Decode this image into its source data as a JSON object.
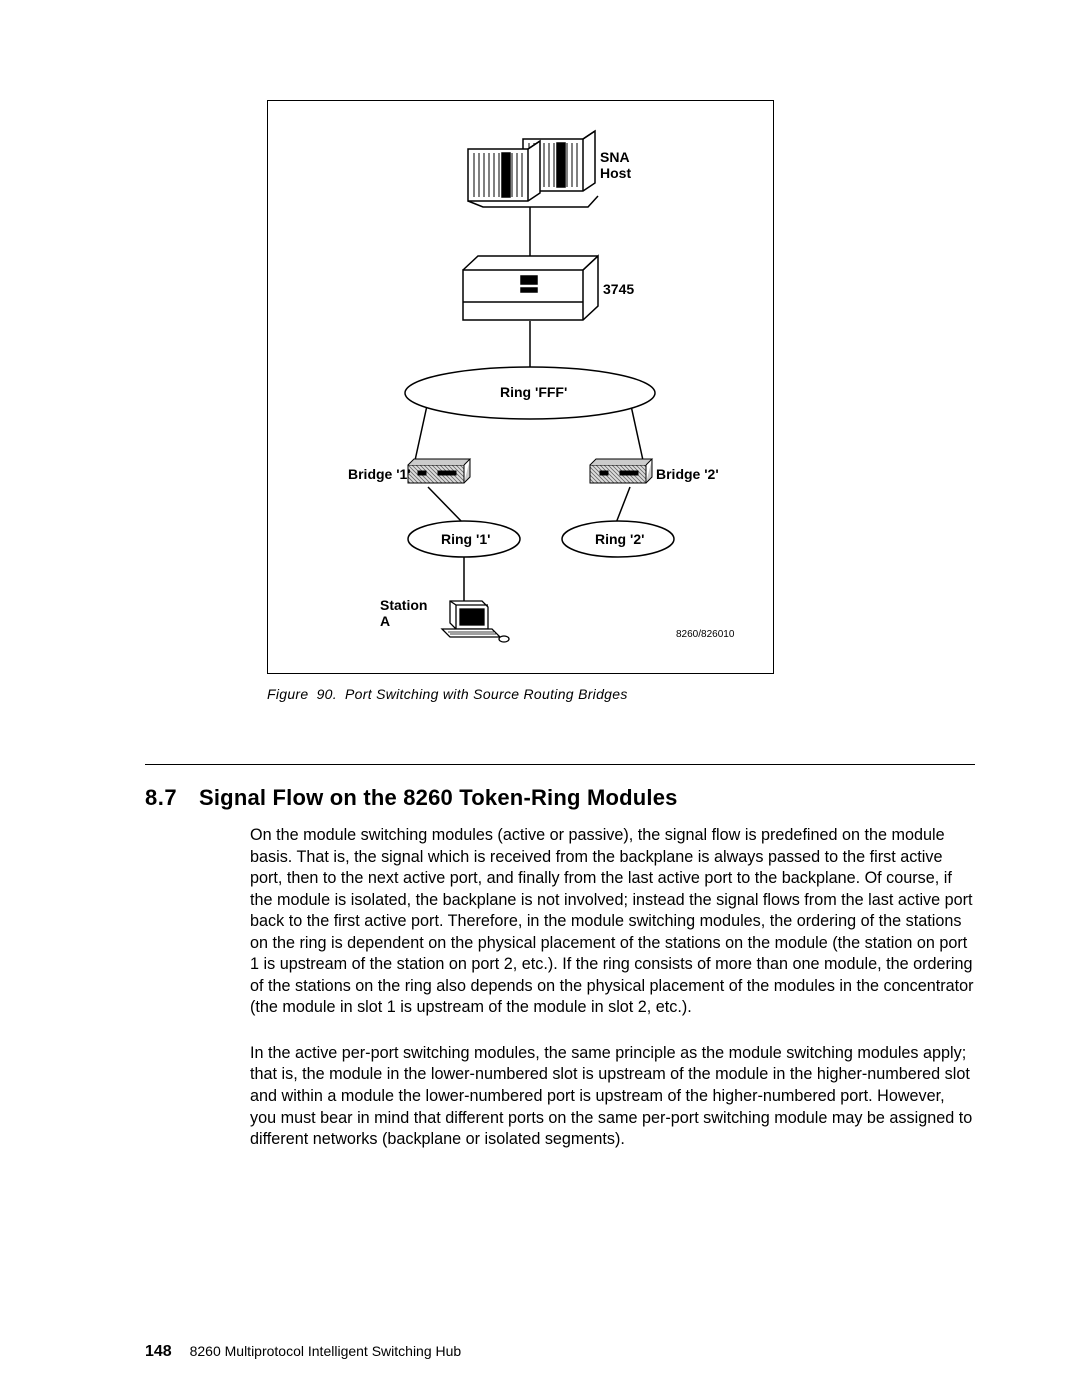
{
  "diagram": {
    "labels": {
      "sna_host": "SNA\nHost",
      "fep": "3745",
      "ring_top": "Ring 'FFF'",
      "bridge_left": "Bridge '1'",
      "bridge_right": "Bridge '2'",
      "ring_left": "Ring '1'",
      "ring_right": "Ring '2'",
      "station": "Station\nA",
      "refcode": "8260/826010"
    }
  },
  "caption": "Figure 90. Port Switching with Source Routing Bridges",
  "section": {
    "number": "8.7",
    "title": "Signal Flow on the 8260 Token-Ring Modules",
    "paragraphs": [
      "On the module switching modules (active or passive), the signal flow is predefined on the module basis.  That is, the signal which is received from the backplane is always passed to the first active port, then to the next active port, and finally from the last active port to the backplane.  Of course, if the module is isolated, the backplane is not involved; instead the signal flows from the last active port back to the first active port.   Therefore, in the module switching modules, the ordering of the stations on the ring is dependent on the physical placement of the stations on the module (the station on port 1 is upstream of the station on port 2, etc.).  If the ring consists of more than one module, the ordering of the stations on the ring also depends on the physical placement of the modules in the concentrator (the module in slot 1 is upstream of the module in slot 2, etc.).",
      "In the active per-port switching modules, the same principle as the module switching modules apply; that is, the module in the lower-numbered slot is upstream of the module in the higher-numbered slot and within a module the lower-numbered port is upstream of the higher-numbered port.  However, you must bear in mind that different ports on the same per-port switching module may be assigned to different networks (backplane or isolated segments)."
    ]
  },
  "footer": {
    "page_number": "148",
    "title": "8260 Multiprotocol Intelligent Switching Hub"
  }
}
